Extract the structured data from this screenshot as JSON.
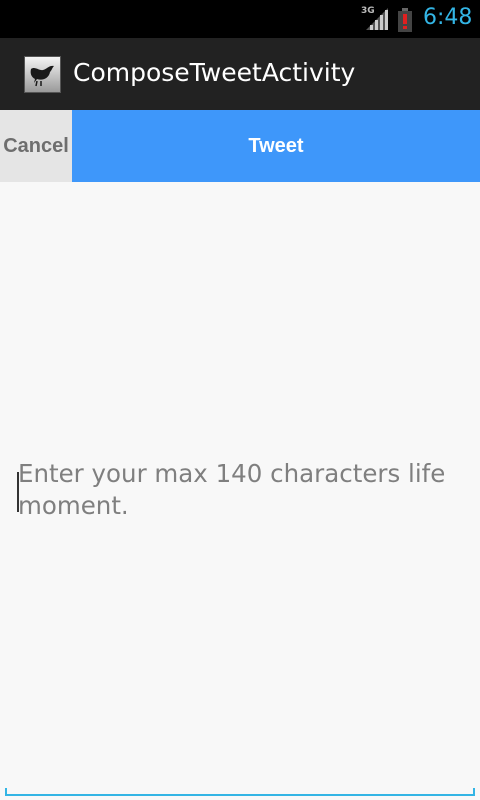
{
  "status_bar": {
    "network_type": "3G",
    "time": "6:48",
    "icons": [
      "network-3g-icon",
      "signal-icon",
      "battery-alert-icon"
    ]
  },
  "action_bar": {
    "app_icon": "bird-icon",
    "title": "ComposeTweetActivity"
  },
  "buttons": {
    "cancel_label": "Cancel",
    "tweet_label": "Tweet"
  },
  "compose": {
    "value": "",
    "placeholder": "Enter your max 140 characters life moment."
  },
  "colors": {
    "accent": "#33b5e5",
    "tweet_button": "#3e97fa",
    "cancel_button": "#e5e5e5",
    "action_bar": "#222222",
    "status_bar": "#000000"
  }
}
